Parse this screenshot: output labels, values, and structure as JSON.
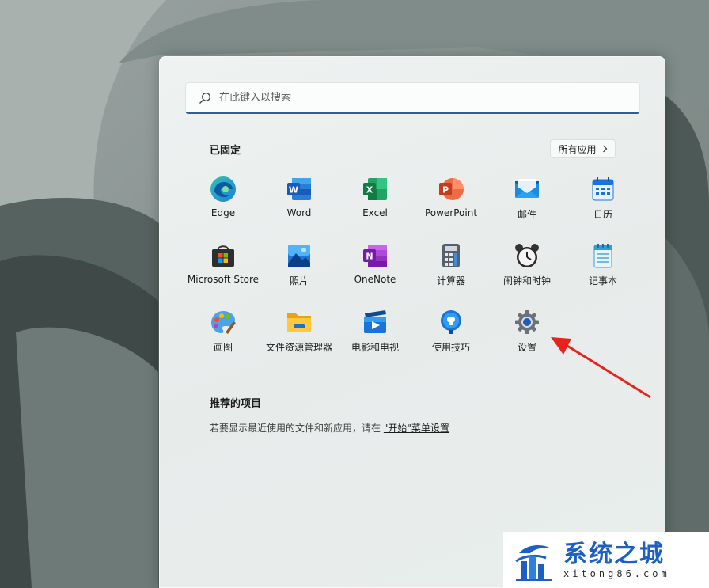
{
  "search": {
    "placeholder": "在此键入以搜索"
  },
  "pinned": {
    "title": "已固定",
    "all_apps_label": "所有应用",
    "apps": [
      {
        "label": "Edge",
        "icon": "edge-icon"
      },
      {
        "label": "Word",
        "icon": "word-icon"
      },
      {
        "label": "Excel",
        "icon": "excel-icon"
      },
      {
        "label": "PowerPoint",
        "icon": "powerpoint-icon"
      },
      {
        "label": "邮件",
        "icon": "mail-icon"
      },
      {
        "label": "日历",
        "icon": "calendar-icon"
      },
      {
        "label": "Microsoft Store",
        "icon": "store-icon"
      },
      {
        "label": "照片",
        "icon": "photos-icon"
      },
      {
        "label": "OneNote",
        "icon": "onenote-icon"
      },
      {
        "label": "计算器",
        "icon": "calculator-icon"
      },
      {
        "label": "闹钟和时钟",
        "icon": "alarm-clock-icon"
      },
      {
        "label": "记事本",
        "icon": "notepad-icon"
      },
      {
        "label": "画图",
        "icon": "paint-icon"
      },
      {
        "label": "文件资源管理器",
        "icon": "file-explorer-icon"
      },
      {
        "label": "电影和电视",
        "icon": "movies-tv-icon"
      },
      {
        "label": "使用技巧",
        "icon": "tips-icon"
      },
      {
        "label": "设置",
        "icon": "settings-icon"
      }
    ]
  },
  "recommended": {
    "title": "推荐的项目",
    "text_prefix": "若要显示最近使用的文件和新应用，请在 ",
    "link_text": "\"开始\"菜单设置"
  },
  "watermark": {
    "name": "系统之城",
    "url": "xitong86.com"
  },
  "colors": {
    "accent": "#2f5f8a",
    "arrow": "#e8231c",
    "watermark_blue": "#1e5fc4"
  }
}
